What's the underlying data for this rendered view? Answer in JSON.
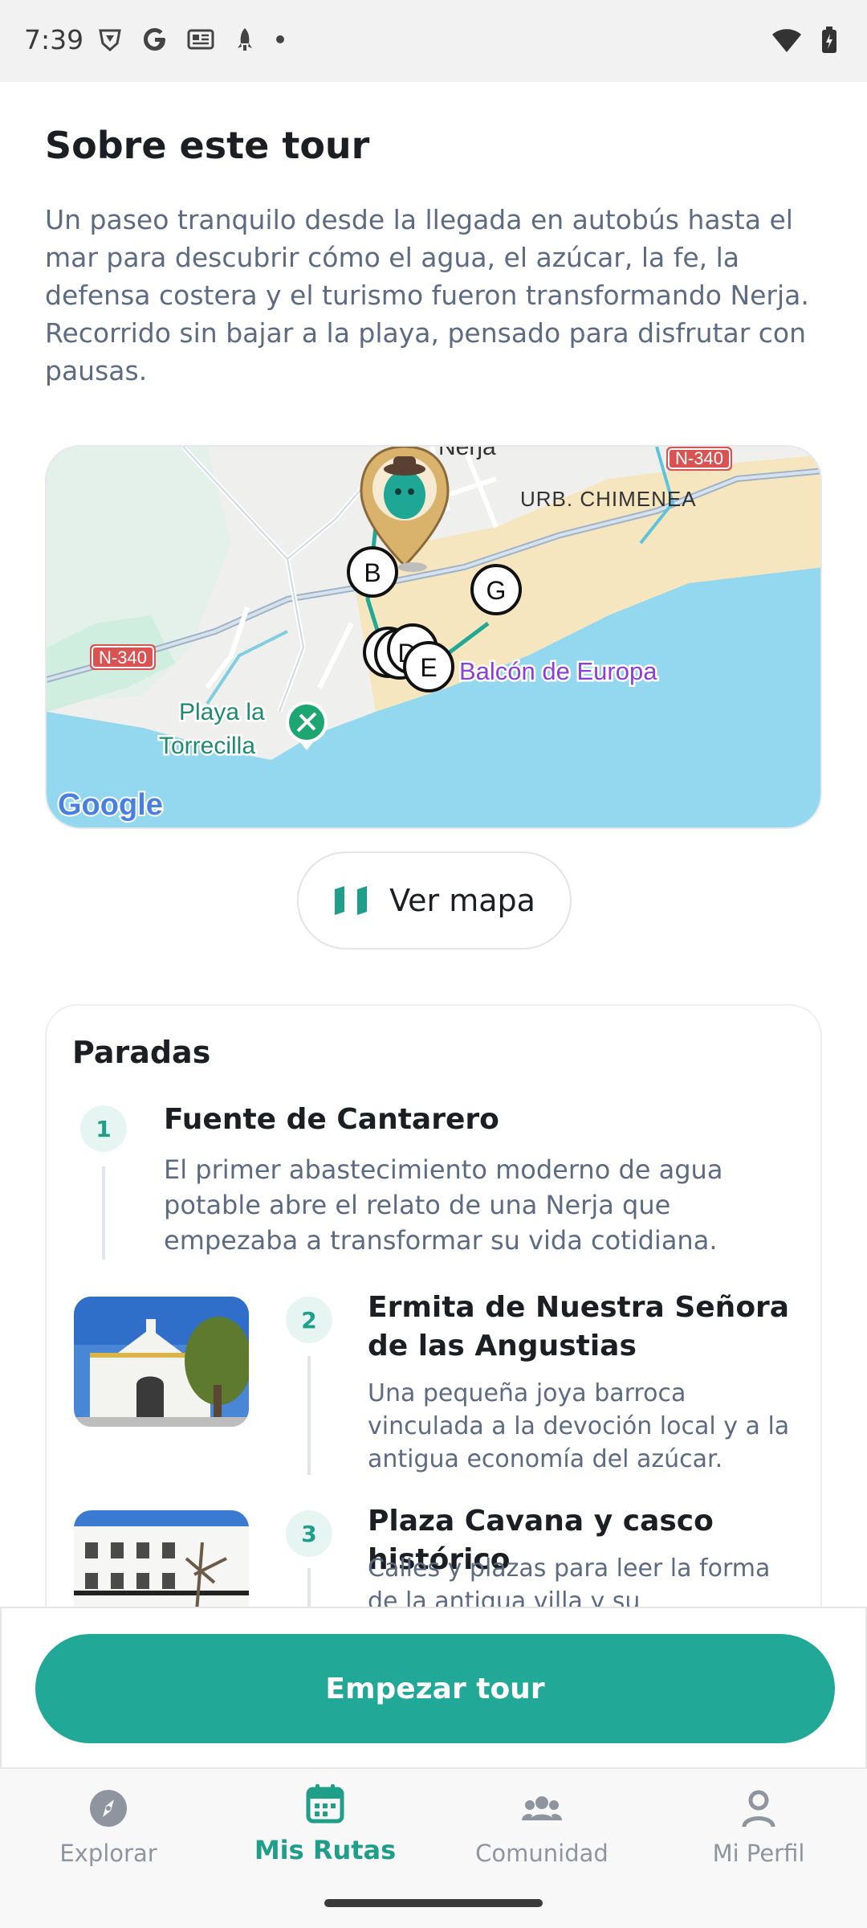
{
  "status_bar": {
    "time": "7:39",
    "left_icons": [
      "brave-icon",
      "google-icon",
      "news-icon",
      "rocket-icon",
      "dot-icon"
    ],
    "right_icons": [
      "wifi-icon",
      "battery-charging-icon"
    ]
  },
  "about": {
    "title": "Sobre este tour",
    "description": "Un paseo tranquilo desde la llegada en autobús hasta el mar para descubrir cómo el agua, el azúcar, la fe, la defensa costera y el turismo fueron transformando Nerja. Recorrido sin bajar a la playa, pensado para disfrutar con pausas."
  },
  "map": {
    "labels": {
      "town": "Nerja",
      "district": "URB. CHIMENEA",
      "road_top": "N-340",
      "road_left": "N-340",
      "beach_line1": "Playa la",
      "beach_line2": "Torrecilla",
      "viewpoint": "Balcón de Europa",
      "attribution": "Google"
    },
    "markers": [
      "B",
      "G",
      "D",
      "E"
    ],
    "colors": {
      "sea": "#93d8ee",
      "route": "#22a896",
      "viewpoint": "#8a3fd6"
    }
  },
  "view_map_button": {
    "label": "Ver mapa",
    "icon": "map-icon"
  },
  "stops": {
    "title": "Paradas",
    "items": [
      {
        "number": "1",
        "name": "Fuente de Cantarero",
        "description": "El primer abastecimiento moderno de agua potable abre el relato de una Nerja que empezaba a transformar su vida cotidiana."
      },
      {
        "number": "2",
        "name": "Ermita de Nuestra Señora de las Angustias",
        "description": "Una pequeña joya barroca vinculada a la devoción local y a la antigua economía del azúcar."
      },
      {
        "number": "3",
        "name": "Plaza Cavana y casco histórico",
        "description": "Calles y plazas para leer la forma de la antigua villa y su crecimiento"
      }
    ]
  },
  "cta": {
    "label": "Empezar tour"
  },
  "nav": {
    "items": [
      {
        "label": "Explorar",
        "icon": "compass-icon"
      },
      {
        "label": "Mis Rutas",
        "icon": "calendar-icon"
      },
      {
        "label": "Comunidad",
        "icon": "people-icon"
      },
      {
        "label": "Mi Perfil",
        "icon": "person-icon"
      }
    ],
    "active_color": "#1f9f89",
    "inactive_color": "#8e959e"
  }
}
